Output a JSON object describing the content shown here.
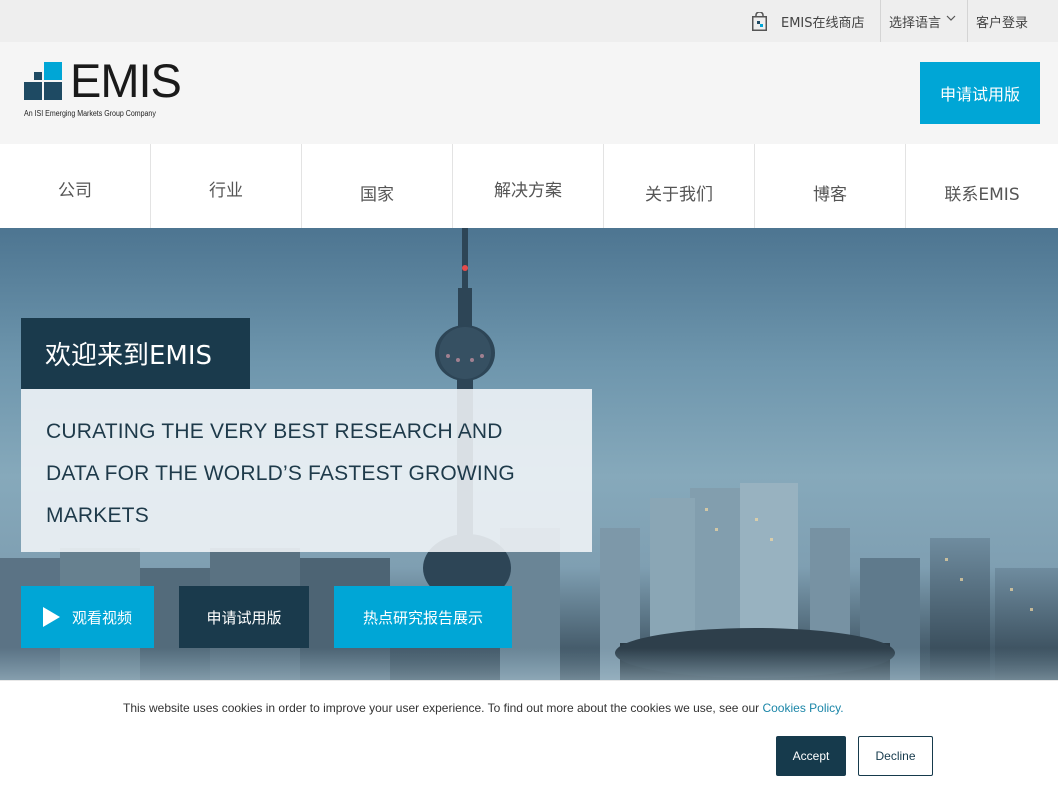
{
  "topbar": {
    "shop_label": "EMIS在线商店",
    "language_label": "选择语言",
    "login_label": "客户登录"
  },
  "header": {
    "logo_text": "EMIS",
    "logo_tagline": "An ISI Emerging Markets Group Company",
    "trial_button": "申请试用版"
  },
  "nav": {
    "items": [
      {
        "label": "公司"
      },
      {
        "label": "行业"
      },
      {
        "label": "国家"
      },
      {
        "label": "解决方案"
      },
      {
        "label": "关于我们"
      },
      {
        "label": "博客"
      },
      {
        "label": "联系EMIS"
      }
    ]
  },
  "hero": {
    "welcome": "欢迎来到EMIS",
    "tagline_lines": [
      "CURATING THE VERY BEST RESEARCH AND",
      "DATA FOR THE WORLD’S FASTEST GROWING",
      "MARKETS"
    ],
    "watch_video_button": "观看视频",
    "trial_button": "申请试用版",
    "reports_button": "热点研究报告展示"
  },
  "cookie": {
    "text": "This website uses cookies in order to improve your user experience. To find out more about the cookies we use, see our",
    "link": "Cookies Policy",
    "period": ".",
    "accept": "Accept",
    "decline": "Decline"
  },
  "colors": {
    "brand_blue": "#00a6d6",
    "dark_navy": "#163a4c",
    "logo_navy": "#1e4a63"
  },
  "icons": {
    "shop": "shopping-bag-icon",
    "language": "chevron-down-icon",
    "video": "play-icon"
  }
}
